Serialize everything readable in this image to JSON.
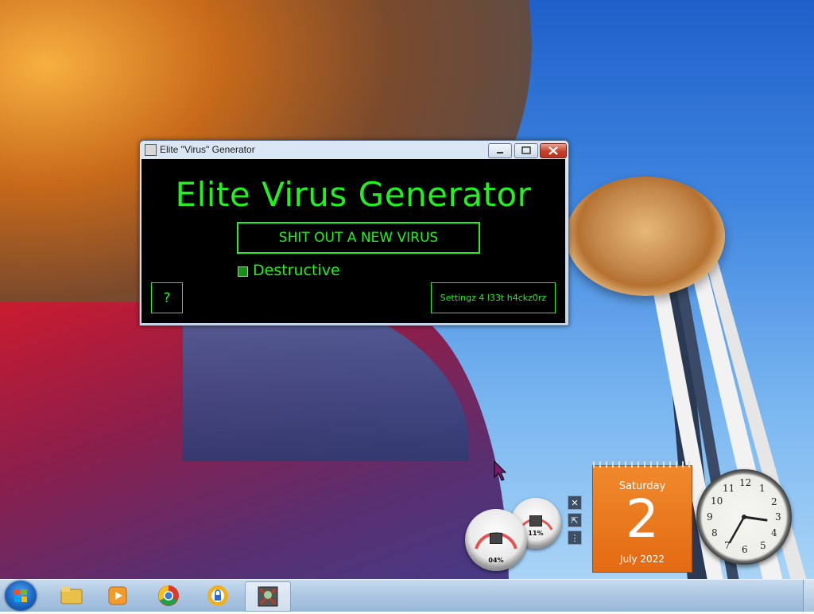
{
  "window": {
    "title": "Elite \"Virus\" Generator",
    "heading": "Elite Virus Generator",
    "new_virus_button": "SHIT OUT A NEW VIRUS",
    "destructive_label": "Destructive",
    "help_button": "?",
    "settings_button": "Settingz 4 l33t h4ckz0rz",
    "accent_color": "#22f020"
  },
  "gadgets": {
    "cpu_meter": {
      "label": "04%",
      "value_percent": 4
    },
    "mem_meter": {
      "label": "11%",
      "value_percent": 11
    },
    "calendar": {
      "day": "Saturday",
      "date": "2",
      "month": "July 2022"
    },
    "clock": {
      "numbers": [
        "12",
        "1",
        "2",
        "3",
        "4",
        "5",
        "6",
        "7",
        "8",
        "9",
        "10",
        "11"
      ],
      "time": "3:35"
    }
  },
  "taskbar": {
    "items": [
      {
        "name": "file-explorer",
        "icon": "folder-icon",
        "color": "#e8c04a"
      },
      {
        "name": "media-player",
        "icon": "media-player-icon",
        "color": "#f29a2a"
      },
      {
        "name": "chrome",
        "icon": "chrome-icon",
        "color": "#d93b2b"
      },
      {
        "name": "vpn-app",
        "icon": "lock-icon",
        "color": "#f0b020"
      },
      {
        "name": "elite-virus-generator",
        "icon": "app-icon",
        "color": "#c03a2a"
      }
    ]
  }
}
